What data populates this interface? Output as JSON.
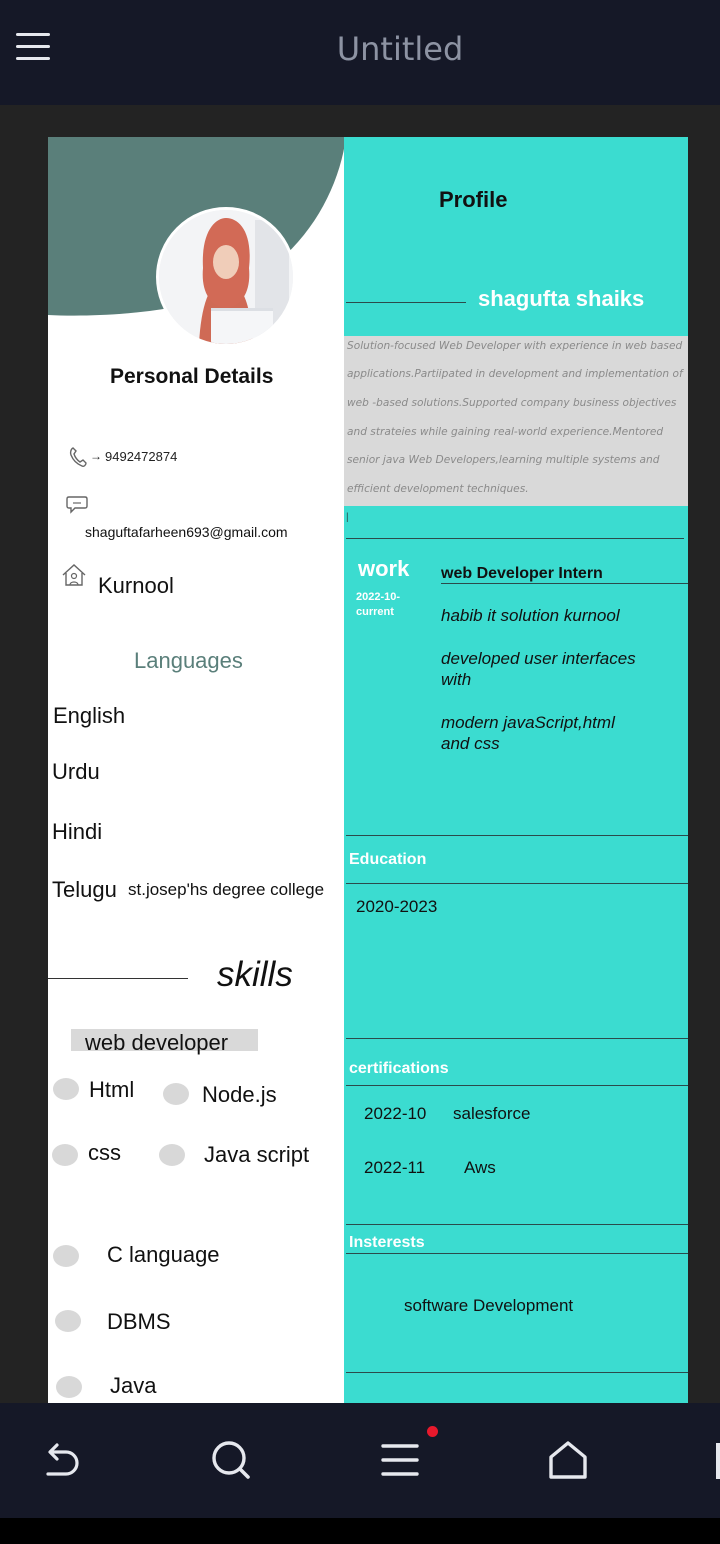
{
  "app": {
    "title": "Untitled"
  },
  "resume": {
    "left": {
      "personal_details_heading": "Personal Details",
      "phone_arrow": "→",
      "phone": "9492472874",
      "email": "shaguftafarheen693@gmail.com",
      "location": "Kurnool",
      "languages_heading": "Languages",
      "languages": [
        "English",
        "Urdu",
        "Hindi",
        "Telugu"
      ],
      "overflow_college": "st.josep'hs degree college",
      "skills_heading": "skills",
      "skills_category": "web developer",
      "skills": [
        "Html",
        "Node.js",
        "css",
        "Java script",
        "C language",
        "DBMS",
        "Java"
      ]
    },
    "right": {
      "profile_heading": "Profile",
      "name": "shagufta shaiks",
      "summary_lines": [
        "Solution-focused Web Developer with experience in web based",
        " applications.Partiipated in development and implementation  of",
        "web -based solutions.Supported company business objectives",
        "and strateies while gaining real-world experience.Mentored",
        "senior java Web Developers,learning multiple  systems and",
        "efficient development techniques."
      ],
      "summary_cursor": "|",
      "work_heading": "work",
      "work_date_start": "2022-10-",
      "work_date_end": "current",
      "work_title": "web Developer Intern",
      "work_company": "habib it solution kurnool",
      "work_desc_1": [
        "developed user interfaces",
        "with"
      ],
      "work_desc_2": [
        "modern javaScript,html",
        "and css"
      ],
      "education_heading": "Education",
      "education_years": "2020-2023",
      "certifications_heading": "certifications",
      "certifications": [
        {
          "date": "2022-10",
          "name": "salesforce"
        },
        {
          "date": "2022-11",
          "name": "Aws"
        }
      ],
      "interests_heading": "Insterests",
      "interest": "software Development"
    }
  },
  "colors": {
    "teal": "#3bdcd0",
    "slate_green": "#5a7f7a",
    "app_bar": "#151827",
    "workspace": "#232323",
    "notification_dot": "#e8192c"
  },
  "nav": {
    "icons": [
      "undo-icon",
      "search-icon",
      "menu-icon",
      "home-icon"
    ]
  }
}
